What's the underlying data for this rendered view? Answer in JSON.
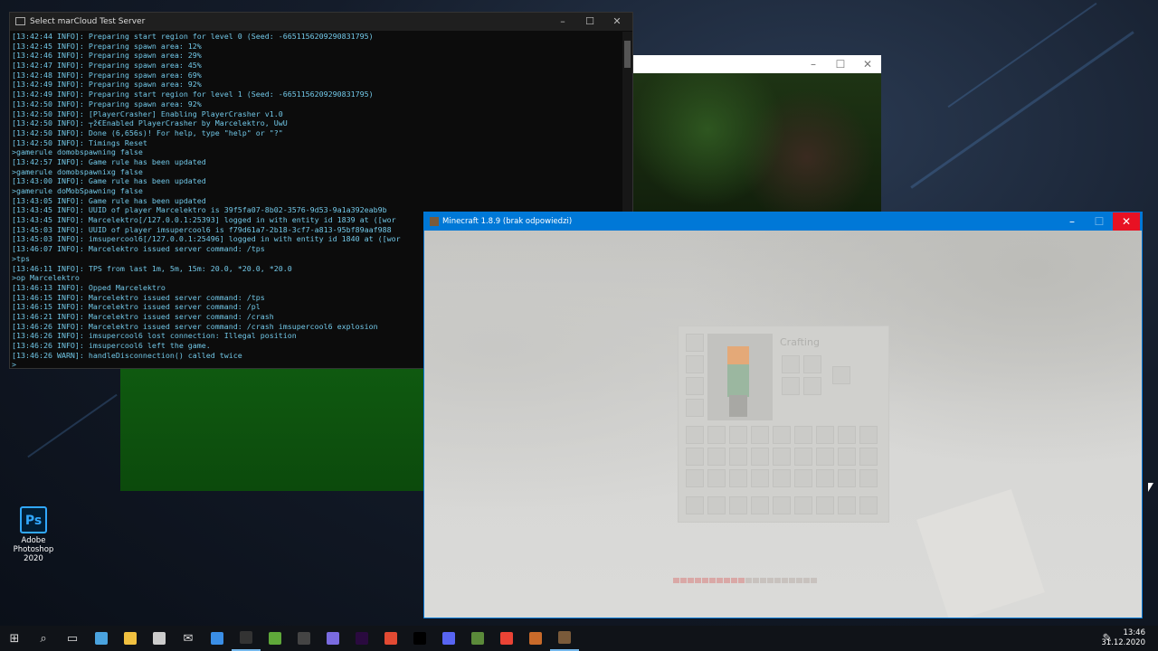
{
  "desktop": {
    "icons": [
      {
        "label": "Adobe Photoshop 2020",
        "logo": "Ps",
        "icon": "photoshop-icon"
      }
    ]
  },
  "console": {
    "title": "Select marCloud Test Server",
    "lines": [
      "[13:42:44 INFO]: Preparing start region for level 0 (Seed: -6651156209290831795)",
      "[13:42:45 INFO]: Preparing spawn area: 12%",
      "[13:42:46 INFO]: Preparing spawn area: 29%",
      "[13:42:47 INFO]: Preparing spawn area: 45%",
      "[13:42:48 INFO]: Preparing spawn area: 69%",
      "[13:42:49 INFO]: Preparing spawn area: 92%",
      "[13:42:49 INFO]: Preparing start region for level 1 (Seed: -6651156209290831795)",
      "[13:42:50 INFO]: Preparing spawn area: 92%",
      "[13:42:50 INFO]: [PlayerCrasher] Enabling PlayerCrasher v1.0",
      "[13:42:50 INFO]: ┬ž€Enabled PlayerCrasher by Marcelektro, UwU",
      "[13:42:50 INFO]: Done (6,656s)! For help, type \"help\" or \"?\"",
      "[13:42:50 INFO]: Timings Reset",
      ">gamerule domobspawning false",
      "[13:42:57 INFO]: Game rule has been updated",
      ">gamerule domobspawnixg false",
      "[13:43:00 INFO]: Game rule has been updated",
      ">gamerule doMobSpawning false",
      "[13:43:05 INFO]: Game rule has been updated",
      "[13:43:45 INFO]: UUID of player Marcelektro is 39f5fa07-8b02-3576-9d53-9a1a392eab9b",
      "[13:43:45 INFO]: Marcelektro[/127.0.0.1:25393] logged in with entity id 1839 at ([wor",
      "[13:45:03 INFO]: UUID of player imsupercool6 is f79d61a7-2b18-3cf7-a813-95bf89aaf988",
      "[13:45:03 INFO]: imsupercool6[/127.0.0.1:25496] logged in with entity id 1840 at ([wor",
      "[13:46:07 INFO]: Marcelektro issued server command: /tps",
      ">tps",
      "[13:46:11 INFO]: TPS from last 1m, 5m, 15m: 20.0, *20.0, *20.0",
      ">op Marcelektro",
      "[13:46:13 INFO]: Opped Marcelektro",
      "[13:46:15 INFO]: Marcelektro issued server command: /tps",
      "[13:46:15 INFO]: Marcelektro issued server command: /pl",
      "[13:46:21 INFO]: Marcelektro issued server command: /crash",
      "[13:46:26 INFO]: Marcelektro issued server command: /crash imsupercool6 explosion",
      "[13:46:26 INFO]: imsupercool6 lost connection: Illegal position",
      "[13:46:26 INFO]: imsupercool6 left the game.",
      "[13:46:26 WARN]: handleDisconnection() called twice",
      ">"
    ]
  },
  "minecraft": {
    "title": "Minecraft 1.8.9 (brak odpowiedzi)",
    "crafting_label": "Crafting"
  },
  "taskbar": {
    "items": [
      "start-icon",
      "search-icon",
      "task-view-icon",
      "calculator-icon",
      "file-explorer-icon",
      "clock-app-icon",
      "mail-icon",
      "calendar-icon",
      "terminal-icon",
      "notepad-icon",
      "obs-icon",
      "cortana-icon",
      "premiere-icon",
      "git-icon",
      "intellij-icon",
      "discord-icon",
      "minecraft-icon",
      "chrome-icon",
      "fox-app-icon",
      "minecraft-server-icon"
    ],
    "time": "13:46",
    "date": "31.12.2020"
  },
  "colors": {
    "console_text": "#72c8e8",
    "mc_titlebar": "#0078d7",
    "close_red": "#e81123"
  }
}
